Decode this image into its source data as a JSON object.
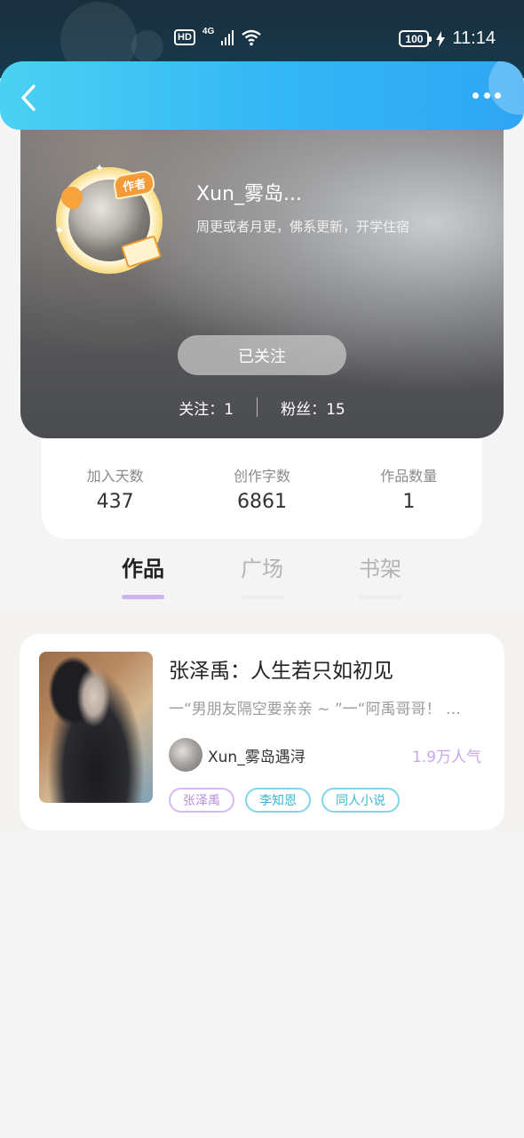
{
  "status_bar": {
    "hd": "HD",
    "network": "4G",
    "battery": "100",
    "time": "11:14"
  },
  "header": {
    "back_icon": "chevron-left-icon",
    "more_icon": "more-dots-icon"
  },
  "profile": {
    "author_tag": "作者",
    "name": "Xun_雾岛...",
    "bio": "周更或者月更，佛系更新，开学住宿",
    "follow_button": "已关注",
    "following_label": "关注：",
    "following_count": "1",
    "fans_label": "粉丝：",
    "fans_count": "15"
  },
  "stats": [
    {
      "label": "加入天数",
      "value": "437"
    },
    {
      "label": "创作字数",
      "value": "6861"
    },
    {
      "label": "作品数量",
      "value": "1"
    }
  ],
  "tabs": [
    {
      "label": "作品",
      "active": true
    },
    {
      "label": "广场",
      "active": false
    },
    {
      "label": "书架",
      "active": false
    }
  ],
  "works": [
    {
      "title": "张泽禹：人生若只如初见",
      "excerpt": "一“男朋友隔空要亲亲 ~ ”一“阿禹哥哥！ …",
      "author": "Xun_雾岛遇浔",
      "popularity": "1.9万人气",
      "tags": [
        {
          "label": "张泽禹",
          "color": "#b98ce4"
        },
        {
          "label": "李知恩",
          "color": "#3cb6cf"
        },
        {
          "label": "同人小说",
          "color": "#3cb6cf"
        }
      ]
    }
  ],
  "colors": {
    "nav_gradient_start": "#4ad1f2",
    "nav_gradient_end": "#2fa6f4",
    "active_tab_underline": "#cfb3ef",
    "popularity": "#c9a6ee"
  }
}
